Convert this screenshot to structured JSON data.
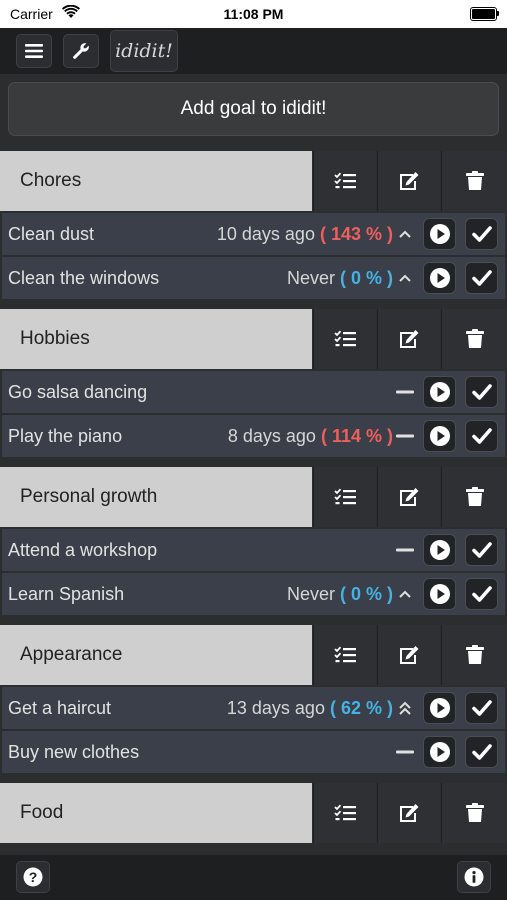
{
  "status_bar": {
    "carrier": "Carrier",
    "time": "11:08 PM"
  },
  "toolbar": {
    "menu_icon": "hamburger-menu-icon",
    "settings_icon": "wrench-icon",
    "logo_text": "ididit!"
  },
  "add_goal_label": "Add goal to ididit!",
  "categories": [
    {
      "title": "Chores",
      "goals": [
        {
          "name": "Clean dust",
          "when": "10 days ago",
          "percent": "( 143 % )",
          "percent_color": "#ef5f5b",
          "trend": "up"
        },
        {
          "name": "Clean the windows",
          "when": "Never",
          "percent": "( 0 % )",
          "percent_color": "#46b2e3",
          "trend": "up"
        }
      ]
    },
    {
      "title": "Hobbies",
      "goals": [
        {
          "name": "Go salsa dancing",
          "when": "",
          "percent": "",
          "percent_color": "",
          "trend": "flat"
        },
        {
          "name": "Play the piano",
          "when": "8 days ago",
          "percent": "( 114 % )",
          "percent_color": "#ef5f5b",
          "trend": "flat"
        }
      ]
    },
    {
      "title": "Personal growth",
      "goals": [
        {
          "name": "Attend a workshop",
          "when": "",
          "percent": "",
          "percent_color": "",
          "trend": "flat"
        },
        {
          "name": "Learn Spanish",
          "when": "Never",
          "percent": "( 0 % )",
          "percent_color": "#46b2e3",
          "trend": "up"
        }
      ]
    },
    {
      "title": "Appearance",
      "goals": [
        {
          "name": "Get a haircut",
          "when": "13 days ago",
          "percent": "( 62 % )",
          "percent_color": "#46b2e3",
          "trend": "double-up"
        },
        {
          "name": "Buy new clothes",
          "when": "",
          "percent": "",
          "percent_color": "",
          "trend": "flat"
        }
      ]
    },
    {
      "title": "Food",
      "goals": []
    }
  ],
  "category_actions": {
    "list_icon": "checklist-icon",
    "edit_icon": "edit-icon",
    "delete_icon": "trash-icon"
  },
  "goal_actions": {
    "start_icon": "play-icon",
    "done_icon": "check-icon"
  },
  "bottom_bar": {
    "help_icon": "help-icon",
    "info_icon": "info-icon"
  },
  "colors": {
    "percent_over": "#ef5f5b",
    "percent_under": "#46b2e3",
    "category_header": "#cfcfcf",
    "goal_row": "#3a3f49"
  }
}
